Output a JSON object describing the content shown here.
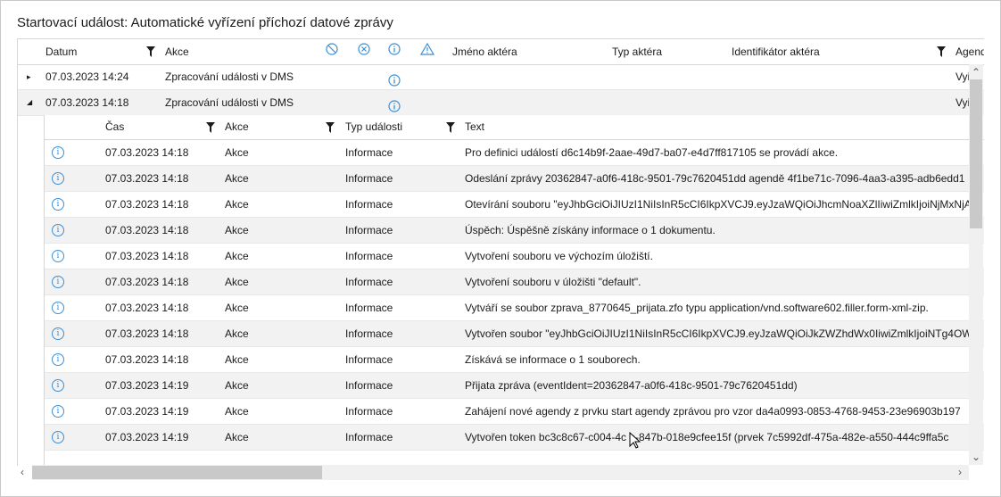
{
  "panel": {
    "title": "Startovací událost: Automatické vyřízení příchozí datové zprávy"
  },
  "outer_grid": {
    "headers": {
      "datum": "Datum",
      "akce": "Akce",
      "jmeno_aktera": "Jméno aktéra",
      "typ_aktera": "Typ aktéra",
      "identifikator_aktera": "Identifikátor aktéra",
      "agenda": "Agend"
    },
    "header_icons": [
      "blocked-icon",
      "cancel-circle-icon",
      "info-icon",
      "warning-icon"
    ],
    "rows": [
      {
        "expander": "▸",
        "datum": "07.03.2023 14:24",
        "akce": "Zpracování události v DMS",
        "agenda": "Vyř"
      },
      {
        "expander": "◢",
        "datum": "07.03.2023 14:18",
        "akce": "Zpracování události v DMS",
        "agenda": "Vyř"
      }
    ]
  },
  "inner_grid": {
    "headers": {
      "cas": "Čas",
      "akce": "Akce",
      "typ": "Typ události",
      "text": "Text"
    },
    "rows": [
      {
        "cas": "07.03.2023 14:18",
        "akce": "Akce",
        "typ": "Informace",
        "text": "Pro definici událostí d6c14b9f-2aae-49d7-ba07-e4d7ff817105 se provádí akce."
      },
      {
        "cas": "07.03.2023 14:18",
        "akce": "Akce",
        "typ": "Informace",
        "text": "Odeslání zprávy 20362847-a0f6-418c-9501-79c7620451dd agendě 4f1be71c-7096-4aa3-a395-adb6edd1"
      },
      {
        "cas": "07.03.2023 14:18",
        "akce": "Akce",
        "typ": "Informace",
        "text": "Otevírání souboru \"eyJhbGciOiJIUzI1NiIsInR5cCI6IkpXVCJ9.eyJzaWQiOiJhcmNoaXZlIiwiZmlkIjoiNjMxNjA1"
      },
      {
        "cas": "07.03.2023 14:18",
        "akce": "Akce",
        "typ": "Informace",
        "text": "Úspěch: Úspěšně získány informace o 1 dokumentu."
      },
      {
        "cas": "07.03.2023 14:18",
        "akce": "Akce",
        "typ": "Informace",
        "text": "Vytvoření souboru ve výchozím úložiští."
      },
      {
        "cas": "07.03.2023 14:18",
        "akce": "Akce",
        "typ": "Informace",
        "text": "Vytvoření souboru v úložišti \"default\"."
      },
      {
        "cas": "07.03.2023 14:18",
        "akce": "Akce",
        "typ": "Informace",
        "text": "Vytváří se soubor zprava_8770645_prijata.zfo typu application/vnd.software602.filler.form-xml-zip."
      },
      {
        "cas": "07.03.2023 14:18",
        "akce": "Akce",
        "typ": "Informace",
        "text": "Vytvořen soubor \"eyJhbGciOiJIUzI1NiIsInR5cCI6IkpXVCJ9.eyJzaWQiOiJkZWZhdWx0IiwiZmlkIjoiNTg4OWU"
      },
      {
        "cas": "07.03.2023 14:18",
        "akce": "Akce",
        "typ": "Informace",
        "text": "Získává se informace o 1 souborech."
      },
      {
        "cas": "07.03.2023 14:19",
        "akce": "Akce",
        "typ": "Informace",
        "text": "Přijata zpráva (eventIdent=20362847-a0f6-418c-9501-79c7620451dd)"
      },
      {
        "cas": "07.03.2023 14:19",
        "akce": "Akce",
        "typ": "Informace",
        "text": "Zahájení nové agendy z prvku start agendy zprávou pro vzor da4a0993-0853-4768-9453-23e96903b197"
      },
      {
        "cas": "07.03.2023 14:19",
        "akce": "Akce",
        "typ": "Informace",
        "text": "Vytvořen token bc3c8c67-c004-4c  e-847b-018e9cfee15f (prvek 7c5992df-475a-482e-a550-444c9ffa5c"
      }
    ]
  },
  "colors": {
    "accent": "#3b8fd6",
    "alt_row": "#f2f2f2",
    "border": "#d6d6d6"
  }
}
